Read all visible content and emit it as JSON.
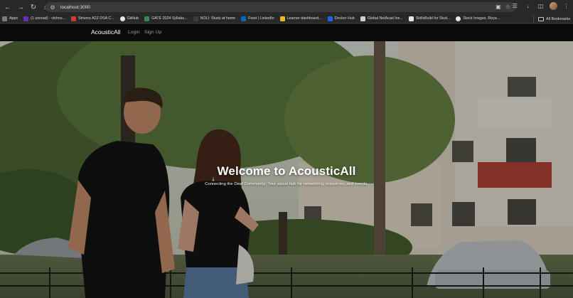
{
  "browser": {
    "url": "localhost:3000",
    "bookmarks": [
      {
        "label": "Apps",
        "icon": "apps-grid-icon",
        "color": "#7a7a7a"
      },
      {
        "label": "(1 unread) - vishnu...",
        "icon": "yahoo-mail-icon",
        "color": "#6a2fb8"
      },
      {
        "label": "Strivers A2Z DSA C...",
        "icon": "strivers-icon",
        "color": "#d23a2f"
      },
      {
        "label": "GitHub",
        "icon": "github-icon",
        "color": "#e6e6e6"
      },
      {
        "label": "GATE 2024 Syllabu...",
        "icon": "gate-icon",
        "color": "#2f8f4e"
      },
      {
        "label": "NOLI: Study at home",
        "icon": "noli-icon",
        "color": "#3a3a3a"
      },
      {
        "label": "Feed | LinkedIn",
        "icon": "linkedin-icon",
        "color": "#0a66c2"
      },
      {
        "label": "Learner dashboard...",
        "icon": "learner-icon",
        "color": "#f0b429"
      },
      {
        "label": "Docker Hub",
        "icon": "docker-icon",
        "color": "#1d63ed"
      },
      {
        "label": "Global NetAcad Ins...",
        "icon": "netacad-icon",
        "color": "#cfcfcf"
      },
      {
        "label": "SkillsBuild for Stud...",
        "icon": "skillsbuild-icon",
        "color": "#e6e6e6"
      },
      {
        "label": "Stock Images, Roya...",
        "icon": "shutterstock-icon",
        "color": "#e6e6e6"
      }
    ],
    "all_bookmarks": "All Bookmarks"
  },
  "navbar": {
    "brand": "AcousticAll",
    "links": [
      "Login",
      "Sign Up"
    ]
  },
  "hero": {
    "title": "Welcome to AcousticAll",
    "subtitle": "Connecting the Deaf Community: Your social hub for networking, resources, and events."
  }
}
